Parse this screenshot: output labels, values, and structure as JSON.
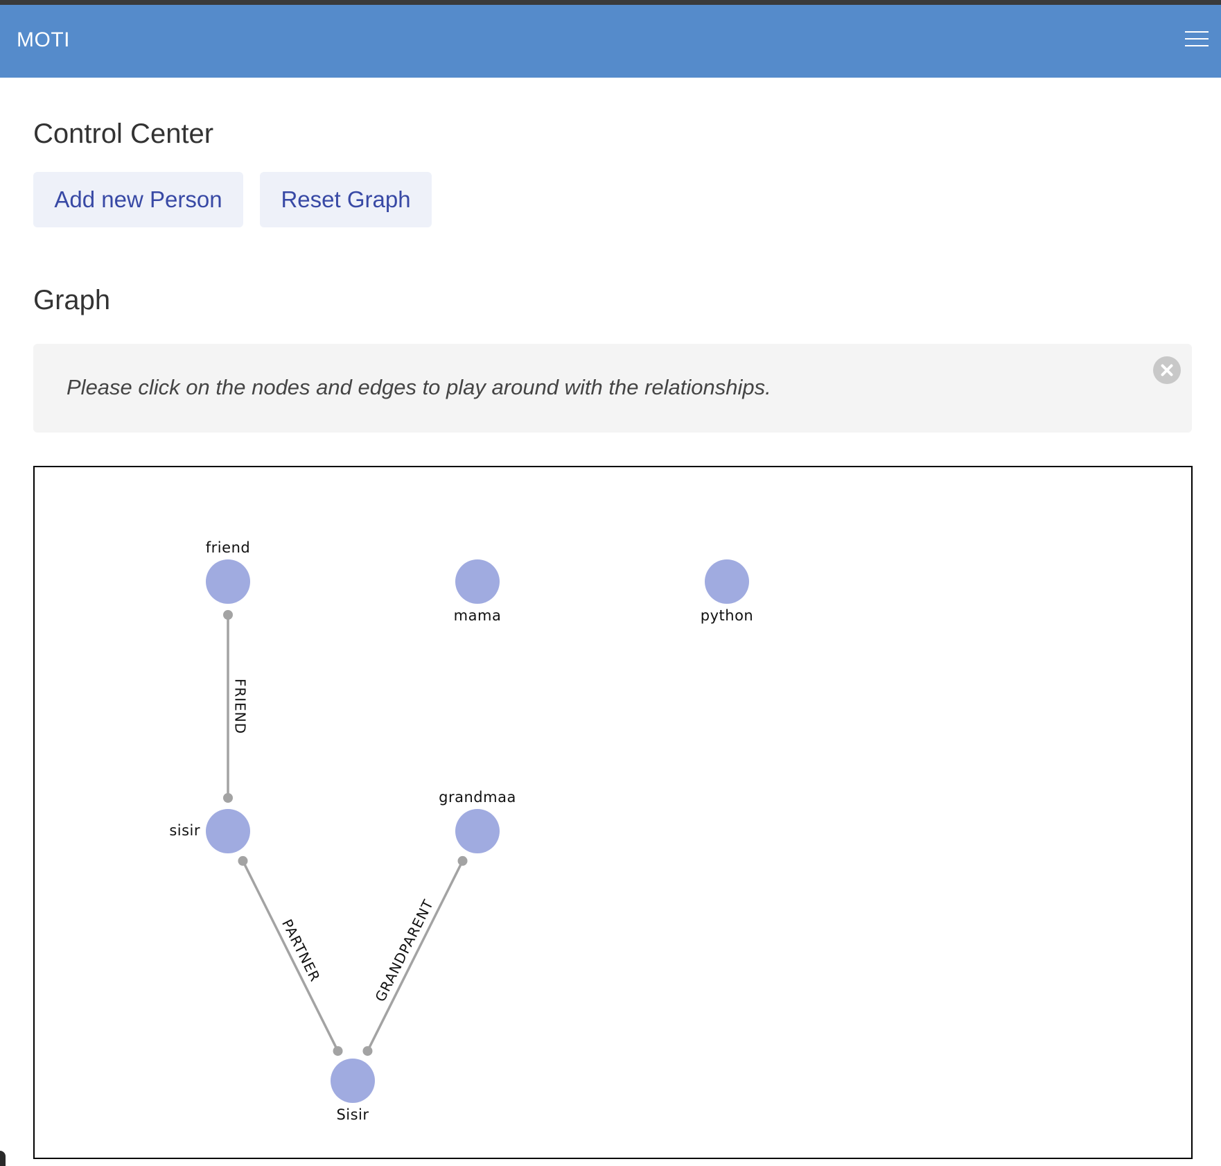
{
  "navbar": {
    "brand": "MOTI",
    "menu_icon": "hamburger-menu-icon"
  },
  "control_center": {
    "title": "Control Center",
    "add_person_label": "Add new Person",
    "reset_graph_label": "Reset Graph"
  },
  "graph_section": {
    "title": "Graph",
    "notice": "Please click on the nodes and edges to play around with the relationships.",
    "close_icon": "close-circle-icon"
  },
  "graph": {
    "nodes": [
      {
        "id": "friend",
        "label": "friend"
      },
      {
        "id": "mama",
        "label": "mama"
      },
      {
        "id": "python",
        "label": "python"
      },
      {
        "id": "sisir",
        "label": "sisir"
      },
      {
        "id": "grandmaa",
        "label": "grandmaa"
      },
      {
        "id": "Sisir",
        "label": "Sisir"
      }
    ],
    "edges": [
      {
        "from": "friend",
        "to": "sisir",
        "label": "FRIEND"
      },
      {
        "from": "sisir",
        "to": "Sisir",
        "label": "PARTNER"
      },
      {
        "from": "grandmaa",
        "to": "Sisir",
        "label": "GRANDPARENT"
      }
    ],
    "colors": {
      "node_fill": "#a0abe0",
      "edge_stroke": "#a3a3a3"
    }
  }
}
